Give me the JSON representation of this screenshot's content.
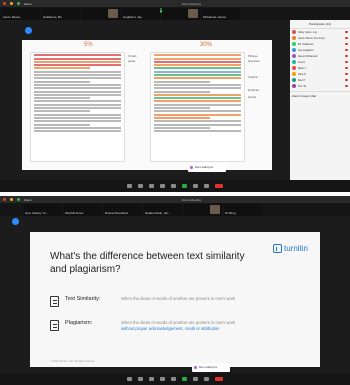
{
  "top": {
    "app_name": "Zoom",
    "window_title": "Zoom Meeting",
    "share_banner": "You are viewing Nicky's screen",
    "tiles": [
      {
        "name": "Aaron Moore"
      },
      {
        "name": "Guillaume, Bo"
      },
      {
        "name": ""
      },
      {
        "name": "Guglielmi, Jay"
      },
      {
        "name": ""
      },
      {
        "name": "Mohamed, Hamo"
      }
    ],
    "slide": {
      "left_pct": "5%",
      "right_pct": "30%",
      "left_side_labels": [
        "Chunk",
        "paste"
      ],
      "right_side_labels": [
        "Phrase",
        "Question",
        "Citation",
        "Emphas",
        "Quote"
      ]
    },
    "panel": {
      "title": "Participants (14)",
      "participants": [
        {
          "name": "Nicky (Host, me)",
          "color": "#d9534f"
        },
        {
          "name": "Aaron Moore (Co-host)",
          "color": "#e67e22"
        },
        {
          "name": "Bo Guillaume",
          "color": "#2ecc71"
        },
        {
          "name": "Jay Guglielmi",
          "color": "#3498db"
        },
        {
          "name": "Hamo Mohamed",
          "color": "#9b59b6"
        },
        {
          "name": "Lisa K",
          "color": "#1abc9c"
        },
        {
          "name": "Mark T",
          "color": "#e74c3c"
        },
        {
          "name": "Rina S",
          "color": "#f39c12"
        },
        {
          "name": "Dan P",
          "color": "#16a085"
        },
        {
          "name": "Tom W",
          "color": "#8e44ad"
        }
      ],
      "chat_title": "Zoom Group Chat"
    },
    "chat_popup": "Dan Leading for"
  },
  "bottom": {
    "app_name": "Zoom",
    "window_title": "Zoom Meeting",
    "tiles": [
      {
        "name": "Guo Judacy, Yu..."
      },
      {
        "name": "Wunhill Arrow"
      },
      {
        "name": "Drissa Chambers"
      },
      {
        "name": "Nadia Ghisin, Hin..."
      },
      {
        "name": ""
      },
      {
        "name": "Ni Wing"
      }
    ],
    "slide": {
      "logo": "turnitin",
      "heading": "What's the difference between text similarity and plagiarism?",
      "rows": [
        {
          "term": "Text Similarity:",
          "definition": "When the ideas or words of another are present in one's work",
          "emphasis": ""
        },
        {
          "term": "Plagiarism:",
          "definition": "When the ideas or words of another are present in one's work",
          "emphasis": "without proper acknowledgement, credit or attribution"
        }
      ],
      "footer": "© 2020 Turnitin, LLC. All rights reserved."
    },
    "chat_popup": "Dan Leading for"
  },
  "colors": {
    "zoom_blue": "#2d8cff",
    "turnitin_blue": "#1f78c8",
    "share_green": "#1f7a3a",
    "leave_red": "#e0312b"
  }
}
